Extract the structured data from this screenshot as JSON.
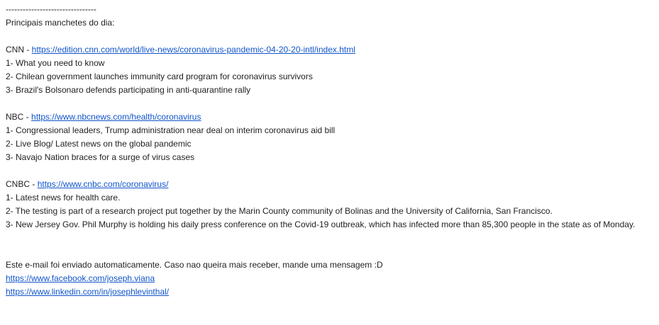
{
  "divider": "--------------------------------",
  "intro": "Principais manchetes do dia:",
  "sources": [
    {
      "name": "CNN",
      "sep": " - ",
      "url": "https://edition.cnn.com/world/live-news/coronavirus-pandemic-04-20-20-intl/index.html",
      "headlines": [
        "1- What you need to know",
        "2- Chilean government launches immunity card program for coronavirus survivors",
        "3- Brazil's Bolsonaro defends participating in anti-quarantine rally"
      ]
    },
    {
      "name": "NBC",
      "sep": " - ",
      "url": "https://www.nbcnews.com/health/coronavirus",
      "headlines": [
        "1- Congressional leaders, Trump administration near deal on interim coronavirus aid bill",
        "2- Live Blog/ Latest news on the global pandemic",
        "3- Navajo Nation braces for a surge of virus cases"
      ]
    },
    {
      "name": "CNBC",
      "sep": " - ",
      "url": "https://www.cnbc.com/coronavirus/",
      "headlines": [
        "1- Latest news for health care.",
        "2- The testing is part of a research project put together by the Marin County community of Bolinas and the University of California, San Francisco.",
        "3- New Jersey Gov. Phil Murphy is holding his daily press conference on the Covid-19 outbreak, which has infected more than 85,300 people in the state as of Monday."
      ]
    }
  ],
  "footer": {
    "message": "Este e-mail foi enviado automaticamente. Caso nao queira mais receber, mande uma mensagem :D",
    "links": [
      "https://www.facebook.com/joseph.viana",
      "https://www.linkedin.com/in/josephlevinthal/"
    ]
  },
  "colors": {
    "text": "#222222",
    "link": "#1155cc",
    "background": "#ffffff"
  }
}
